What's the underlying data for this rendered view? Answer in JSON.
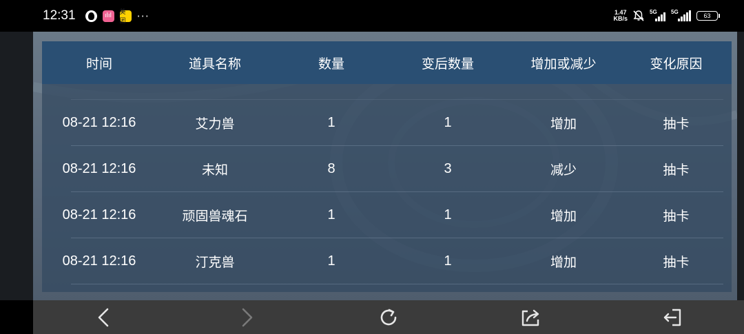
{
  "status_bar": {
    "time": "12:31",
    "app_icons": [
      {
        "name": "qq-icon",
        "glyph": ""
      },
      {
        "name": "pink-app-icon",
        "glyph": "ılıl"
      },
      {
        "name": "meituan-icon",
        "glyph": "美团"
      }
    ],
    "more": "···",
    "net_speed_value": "1.47",
    "net_speed_unit": "KB/s",
    "signal1_label": "5G",
    "signal2_label": "5G",
    "battery": "63"
  },
  "table": {
    "headers": [
      "时间",
      "道具名称",
      "数量",
      "变后数量",
      "增加或减少",
      "变化原因"
    ],
    "rows": [
      [
        "08-21 12:16",
        "艾力兽",
        "1",
        "1",
        "增加",
        "抽卡"
      ],
      [
        "08-21 12:16",
        "未知",
        "8",
        "3",
        "减少",
        "抽卡"
      ],
      [
        "08-21 12:16",
        "顽固兽魂石",
        "1",
        "1",
        "增加",
        "抽卡"
      ],
      [
        "08-21 12:16",
        "汀克兽",
        "1",
        "1",
        "增加",
        "抽卡"
      ]
    ]
  },
  "nav": {
    "icons": [
      "back-icon",
      "forward-icon",
      "refresh-icon",
      "share-icon",
      "exit-icon"
    ]
  },
  "colors": {
    "header_bg": "#2a4f73",
    "table_bg": "#344a62",
    "nav_bg": "#3b3b3b"
  }
}
